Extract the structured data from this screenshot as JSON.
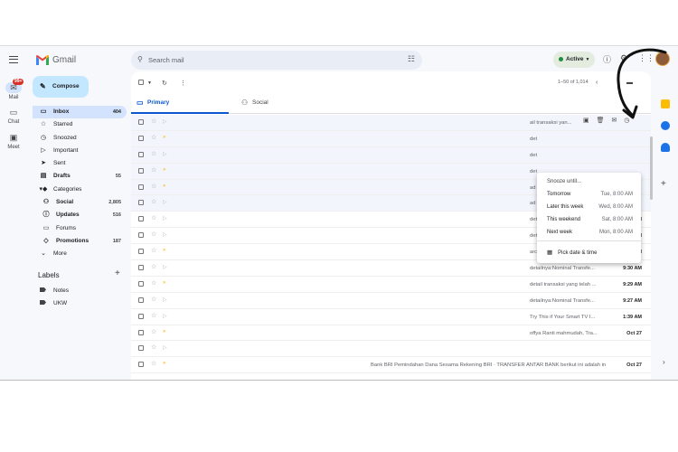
{
  "app": {
    "name": "Gmail"
  },
  "rail": {
    "mail_label": "Mail",
    "mail_badge": "99+",
    "chat_label": "Chat",
    "meet_label": "Meet"
  },
  "search": {
    "placeholder": "Search mail"
  },
  "status": {
    "label": "Active"
  },
  "compose_label": "Compose",
  "nav": [
    {
      "label": "Inbox",
      "count": "404",
      "icon": "inbox-icon"
    },
    {
      "label": "Starred",
      "count": "",
      "icon": "star-icon"
    },
    {
      "label": "Snoozed",
      "count": "",
      "icon": "clock-icon"
    },
    {
      "label": "Important",
      "count": "",
      "icon": "important-icon"
    },
    {
      "label": "Sent",
      "count": "",
      "icon": "send-icon"
    },
    {
      "label": "Drafts",
      "count": "55",
      "icon": "draft-icon"
    },
    {
      "label": "Categories",
      "count": "",
      "icon": "label-icon"
    },
    {
      "label": "Social",
      "count": "2,805",
      "icon": "people-icon"
    },
    {
      "label": "Updates",
      "count": "516",
      "icon": "info-icon"
    },
    {
      "label": "Forums",
      "count": "",
      "icon": "forum-icon"
    },
    {
      "label": "Promotions",
      "count": "187",
      "icon": "tag-icon"
    },
    {
      "label": "More",
      "count": "",
      "icon": "chevron-down-icon"
    }
  ],
  "labels": {
    "heading": "Labels",
    "items": [
      "Notes",
      "UKW"
    ]
  },
  "pager": {
    "text": "1–50 of 1,014"
  },
  "tabs": {
    "primary": "Primary",
    "social": "Social"
  },
  "rows": [
    {
      "preview": "ail transaksi yan...",
      "time": "",
      "important": false
    },
    {
      "preview": "det",
      "time": "",
      "important": true
    },
    {
      "preview": "det",
      "time": "",
      "important": false
    },
    {
      "preview": "det",
      "time": "",
      "important": true
    },
    {
      "preview": "ad",
      "time": "",
      "important": true
    },
    {
      "preview": "ad",
      "time": "",
      "important": false
    },
    {
      "preview": "detailnya:Nominal Transfer...",
      "time": "10:08 AM",
      "important": false
    },
    {
      "preview": "detailnya:Nominal Transfer...",
      "time": "9:34 AM",
      "important": false
    },
    {
      "preview": "archived the card - perban...",
      "time": "9:34 AM",
      "important": true
    },
    {
      "preview": "detailnya:Nominal Transfe...",
      "time": "9:30 AM",
      "important": false
    },
    {
      "preview": "detail transaksi yang telah ...",
      "time": "9:29 AM",
      "important": true
    },
    {
      "preview": "detailnya:Nominal Transfe...",
      "time": "9:27 AM",
      "important": false
    },
    {
      "preview": "Try This if Your Smart TV I...",
      "time": "1:39 AM",
      "important": false
    },
    {
      "preview": "offya Ranti mahmudah, Tra...",
      "time": "Oct 27",
      "important": true
    },
    {
      "preview": "",
      "time": "",
      "important": false
    },
    {
      "preview": "Bank BRI  Pemindahan Dana Sesama Rekening BRI · TRANSFER ANTAR BANK berikut ini adalah informasi transaksi yang telah Anda la...",
      "time": "Oct 27",
      "important": true
    }
  ],
  "snooze": {
    "heading": "Snooze until...",
    "options": [
      {
        "label": "Tomorrow",
        "when": "Tue, 8:00 AM"
      },
      {
        "label": "Later this week",
        "when": "Wed, 8:00 AM"
      },
      {
        "label": "This weekend",
        "when": "Sat, 8:00 AM"
      },
      {
        "label": "Next week",
        "when": "Mon, 8:00 AM"
      }
    ],
    "pick": "Pick date & time"
  }
}
